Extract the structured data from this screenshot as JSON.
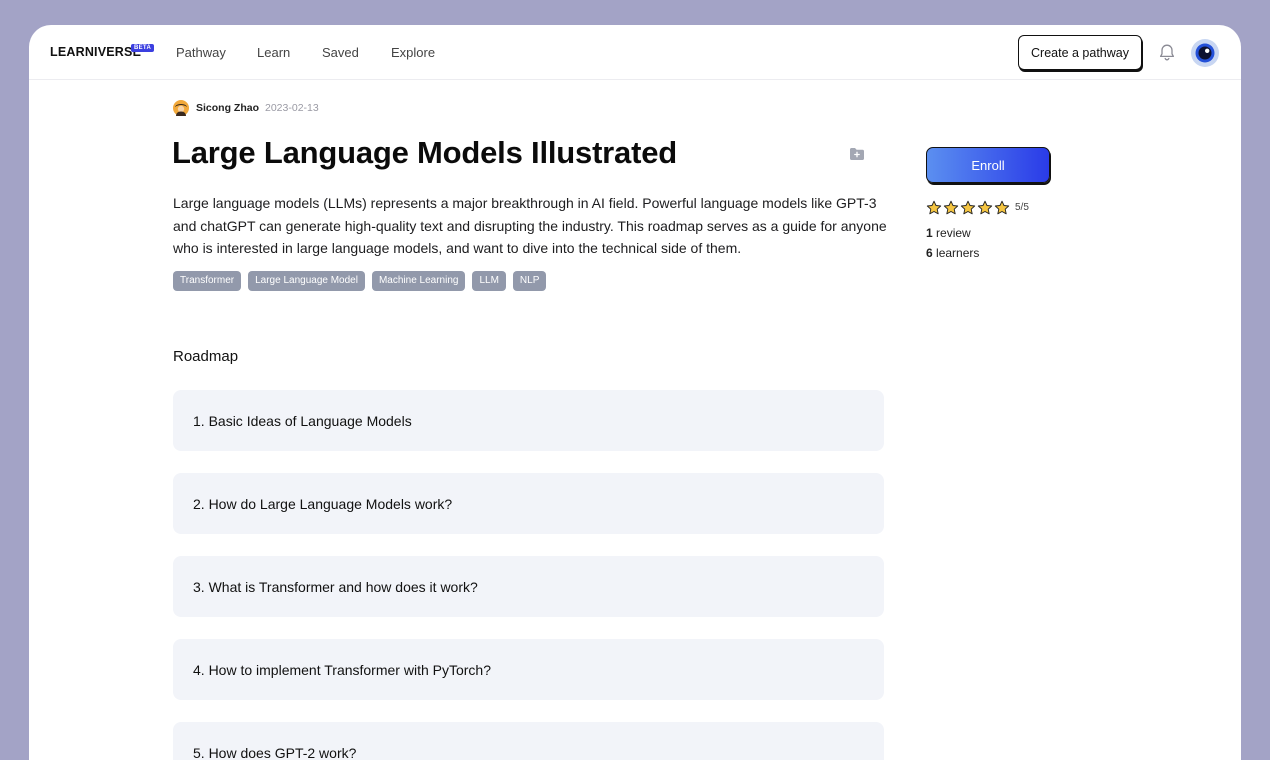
{
  "nav": {
    "logo": "LEARNIVERSE",
    "beta_badge": "BETA",
    "links": [
      "Pathway",
      "Learn",
      "Saved",
      "Explore"
    ],
    "create_button": "Create a pathway"
  },
  "author": {
    "name": "Sicong Zhao",
    "date": "2023-02-13"
  },
  "course": {
    "title": "Large Language Models Illustrated",
    "description": "Large language models (LLMs) represents a major breakthrough in AI field. Powerful language models like GPT-3 and chatGPT can generate high-quality text and disrupting the industry. This roadmap serves as a guide for anyone who is interested in large language models, and want to dive into the technical side of them.",
    "tags": [
      "Transformer",
      "Large Language Model",
      "Machine Learning",
      "LLM",
      "NLP"
    ]
  },
  "sidebar": {
    "enroll_button": "Enroll",
    "rating": 5,
    "rating_max": 5,
    "rating_text": "5/5",
    "reviews_count": "1",
    "reviews_label": " review",
    "learners_count": "6",
    "learners_label": " learners"
  },
  "roadmap": {
    "heading": "Roadmap",
    "items": [
      "1. Basic Ideas of Language Models",
      "2. How do Large Language Models work?",
      "3. What is Transformer and how does it work?",
      "4. How to implement Transformer with PyTorch?",
      "5. How does GPT-2 work?"
    ]
  },
  "colors": {
    "background": "#a3a3c6",
    "accent": "#3b3fe0",
    "star": "#f5c542",
    "tag": "#9299ab"
  }
}
